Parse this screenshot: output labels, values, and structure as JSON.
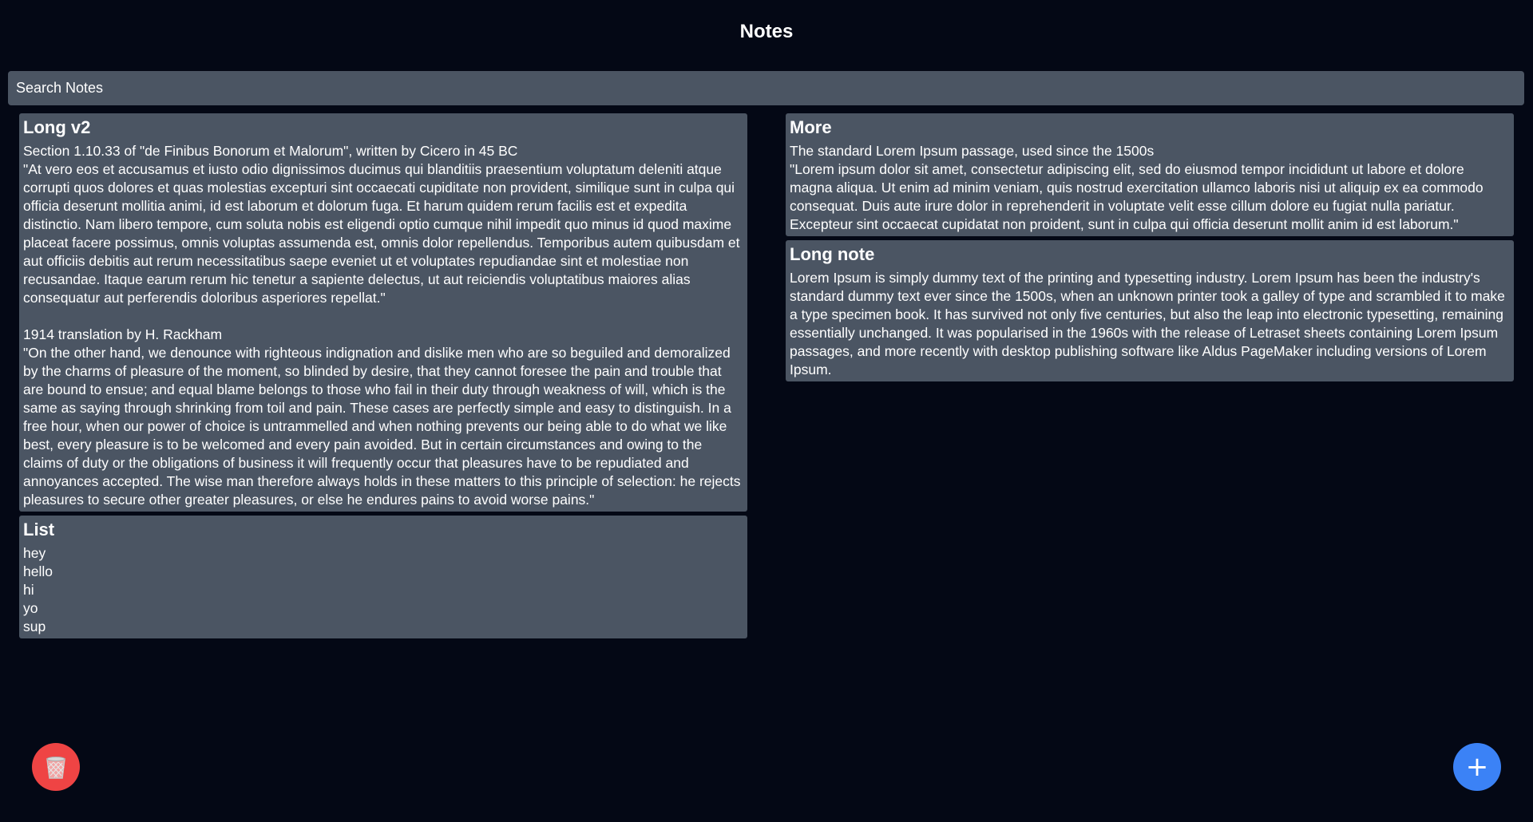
{
  "app": {
    "title": "Notes"
  },
  "search": {
    "placeholder": "Search Notes",
    "value": ""
  },
  "colors": {
    "background": "#040815",
    "card": "#4b5563",
    "trash_button": "#ef4444",
    "add_button": "#3b82f6"
  },
  "notes_left": [
    {
      "title": "Long v2",
      "body": "Section 1.10.33 of \"de Finibus Bonorum et Malorum\", written by Cicero in 45 BC\n\"At vero eos et accusamus et iusto odio dignissimos ducimus qui blanditiis praesentium voluptatum deleniti atque corrupti quos dolores et quas molestias excepturi sint occaecati cupiditate non provident, similique sunt in culpa qui officia deserunt mollitia animi, id est laborum et dolorum fuga. Et harum quidem rerum facilis est et expedita distinctio. Nam libero tempore, cum soluta nobis est eligendi optio cumque nihil impedit quo minus id quod maxime placeat facere possimus, omnis voluptas assumenda est, omnis dolor repellendus. Temporibus autem quibusdam et aut officiis debitis aut rerum necessitatibus saepe eveniet ut et voluptates repudiandae sint et molestiae non recusandae. Itaque earum rerum hic tenetur a sapiente delectus, ut aut reiciendis voluptatibus maiores alias consequatur aut perferendis doloribus asperiores repellat.\"\n\n1914 translation by H. Rackham\n\"On the other hand, we denounce with righteous indignation and dislike men who are so beguiled and demoralized by the charms of pleasure of the moment, so blinded by desire, that they cannot foresee the pain and trouble that are bound to ensue; and equal blame belongs to those who fail in their duty through weakness of will, which is the same as saying through shrinking from toil and pain. These cases are perfectly simple and easy to distinguish. In a free hour, when our power of choice is untrammelled and when nothing prevents our being able to do what we like best, every pleasure is to be welcomed and every pain avoided. But in certain circumstances and owing to the claims of duty or the obligations of business it will frequently occur that pleasures have to be repudiated and annoyances accepted. The wise man therefore always holds in these matters to this principle of selection: he rejects pleasures to secure other greater pleasures, or else he endures pains to avoid worse pains.\""
    },
    {
      "title": "List",
      "body": "hey\nhello\nhi\nyo\nsup"
    }
  ],
  "notes_right": [
    {
      "title": "More",
      "body": "The standard Lorem Ipsum passage, used since the 1500s\n\"Lorem ipsum dolor sit amet, consectetur adipiscing elit, sed do eiusmod tempor incididunt ut labore et dolore magna aliqua. Ut enim ad minim veniam, quis nostrud exercitation ullamco laboris nisi ut aliquip ex ea commodo consequat. Duis aute irure dolor in reprehenderit in voluptate velit esse cillum dolore eu fugiat nulla pariatur. Excepteur sint occaecat cupidatat non proident, sunt in culpa qui officia deserunt mollit anim id est laborum.\""
    },
    {
      "title": "Long note",
      "body": "Lorem Ipsum is simply dummy text of the printing and typesetting industry. Lorem Ipsum has been the industry's standard dummy text ever since the 1500s, when an unknown printer took a galley of type and scrambled it to make a type specimen book. It has survived not only five centuries, but also the leap into electronic typesetting, remaining essentially unchanged. It was popularised in the 1960s with the release of Letraset sheets containing Lorem Ipsum passages, and more recently with desktop publishing software like Aldus PageMaker including versions of Lorem Ipsum."
    }
  ],
  "actions": {
    "trash_icon": "wastebasket-icon",
    "add_icon": "plus-icon",
    "add_label": "+"
  }
}
